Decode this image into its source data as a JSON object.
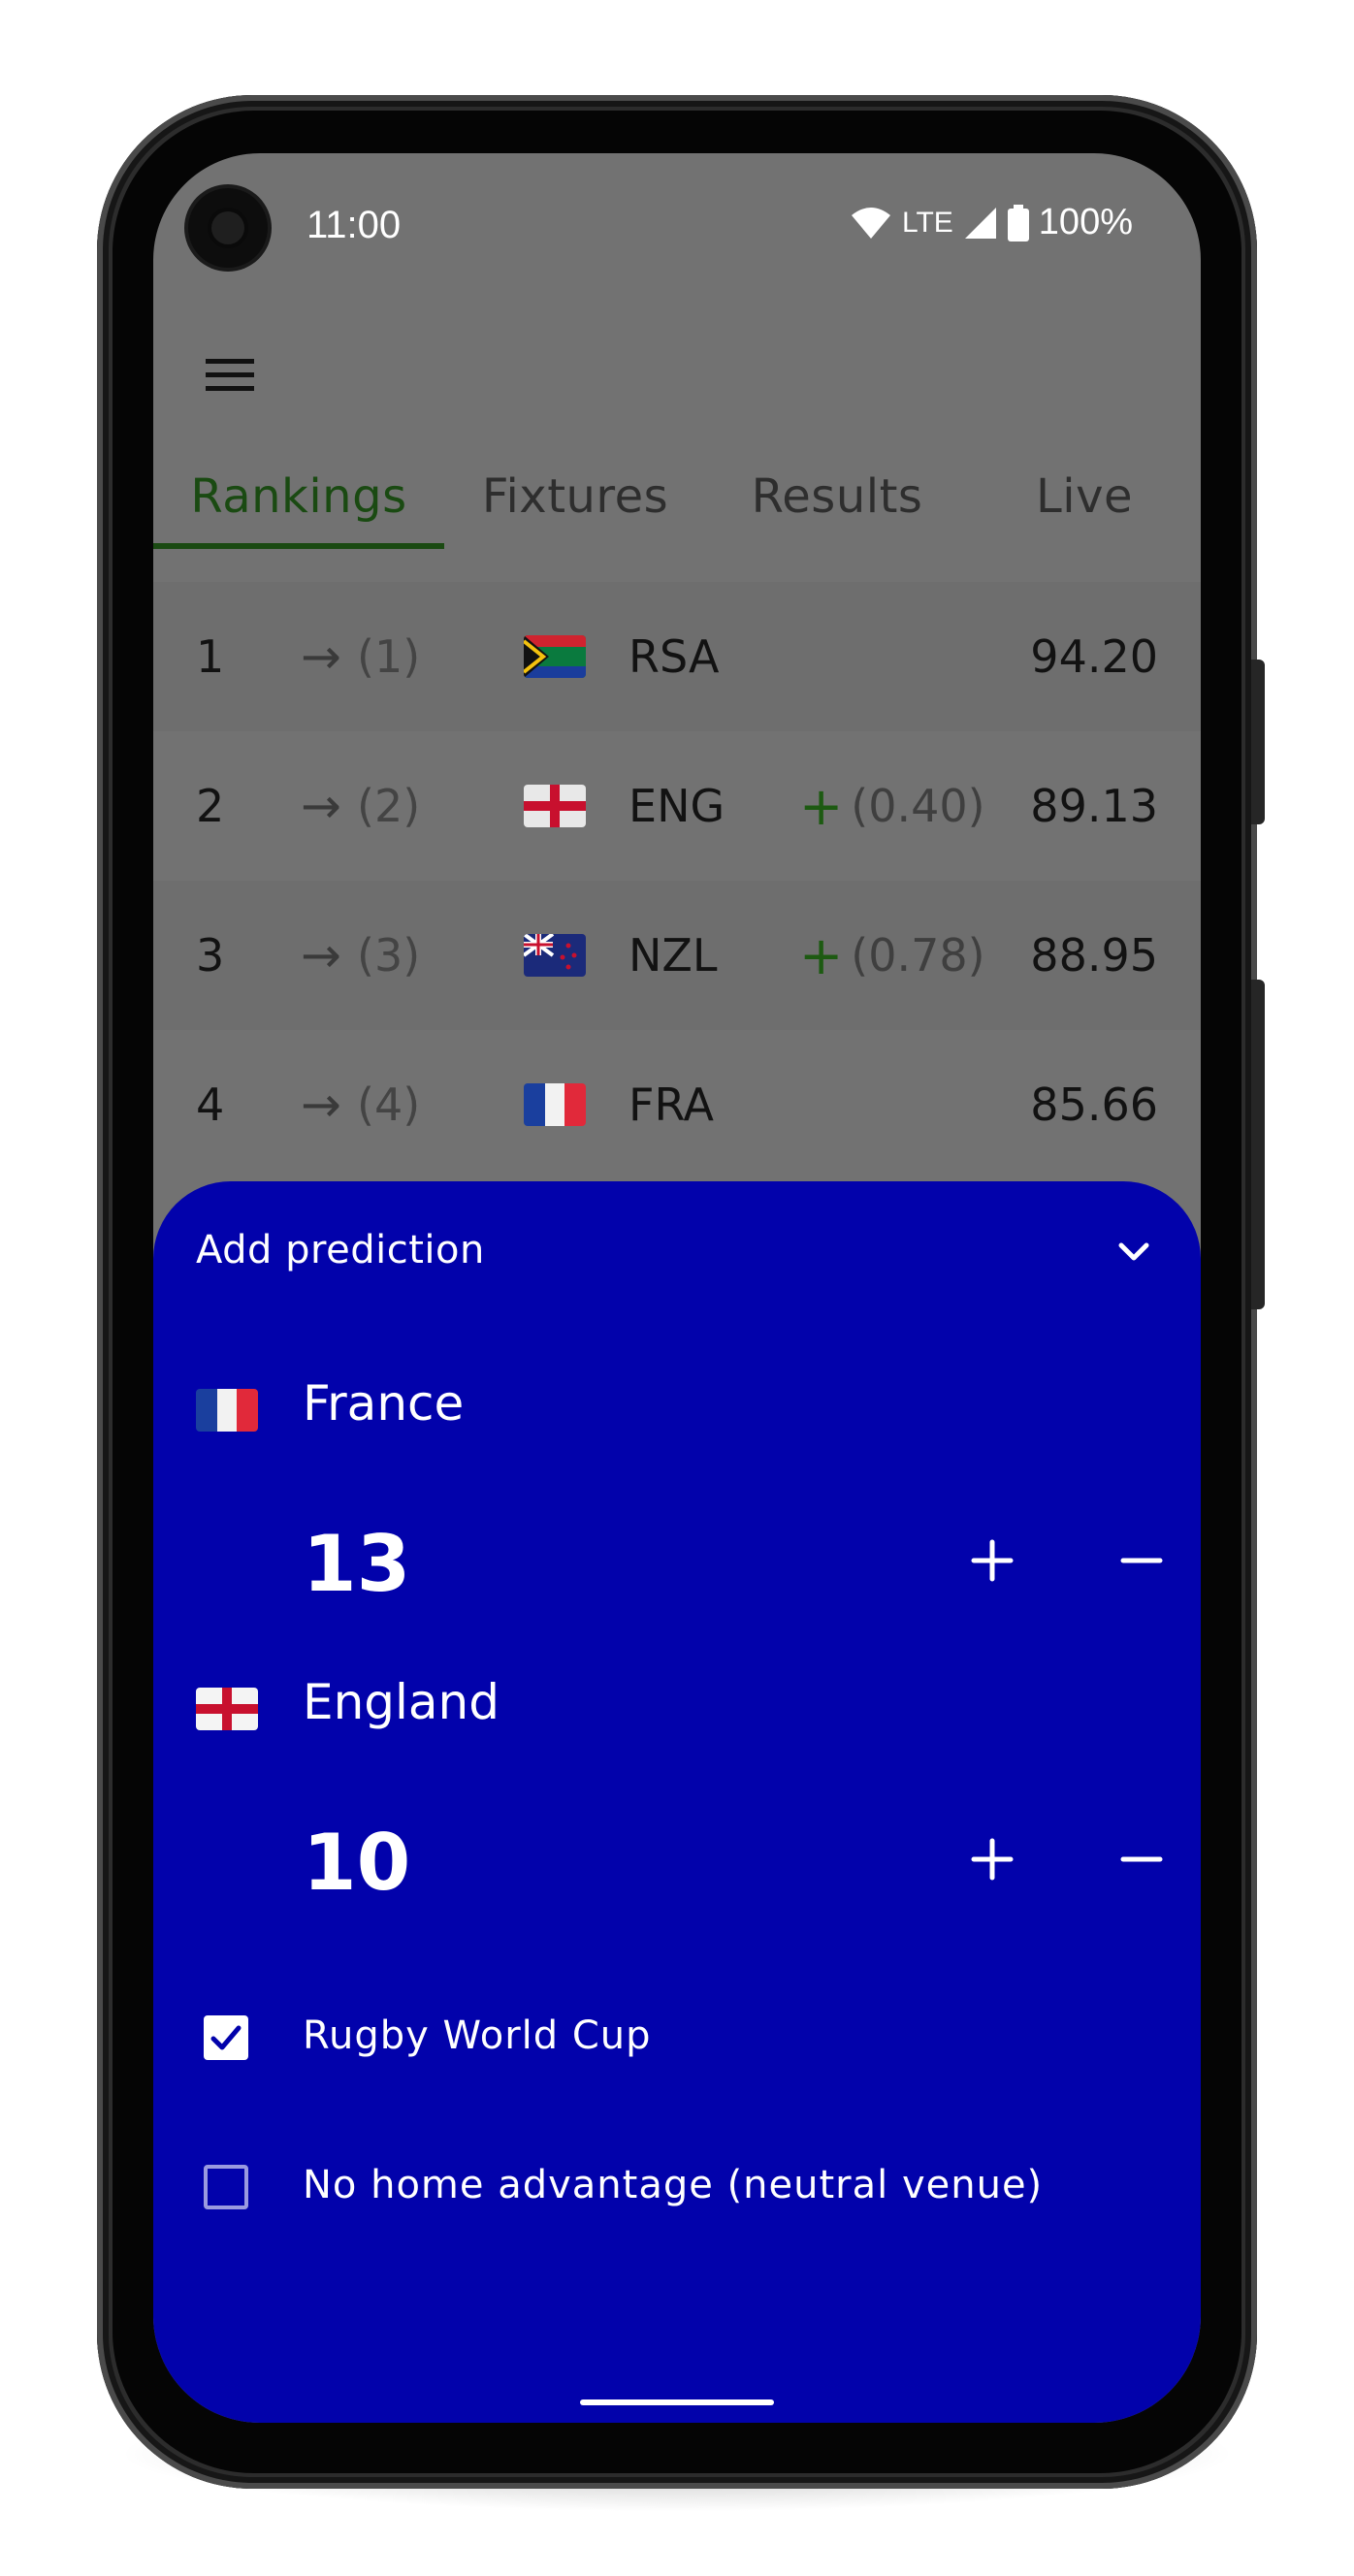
{
  "status_bar": {
    "time": "11:00",
    "network": "LTE",
    "battery": "100%"
  },
  "tabs": [
    {
      "label": "Rankings",
      "active": true
    },
    {
      "label": "Fixtures",
      "active": false
    },
    {
      "label": "Results",
      "active": false
    },
    {
      "label": "Live",
      "active": false
    }
  ],
  "rankings": [
    {
      "position": "1",
      "previous": "(1)",
      "flag": "south-africa-flag",
      "team": "RSA",
      "change": "",
      "points": "94.20"
    },
    {
      "position": "2",
      "previous": "(2)",
      "flag": "england-flag",
      "team": "ENG",
      "change": "(0.40)",
      "points": "89.13"
    },
    {
      "position": "3",
      "previous": "(3)",
      "flag": "new-zealand-flag",
      "team": "NZL",
      "change": "(0.78)",
      "points": "88.95"
    },
    {
      "position": "4",
      "previous": "(4)",
      "flag": "france-flag",
      "team": "FRA",
      "change": "",
      "points": "85.66"
    }
  ],
  "prediction": {
    "title": "Add prediction",
    "home": {
      "team": "France",
      "flag": "france-flag",
      "score": "13"
    },
    "away": {
      "team": "England",
      "flag": "england-flag",
      "score": "10"
    },
    "options": [
      {
        "label": "Rugby World Cup",
        "checked": true
      },
      {
        "label": "No home advantage (neutral venue)",
        "checked": false
      }
    ]
  },
  "colors": {
    "sheet_background": "#0202ab",
    "list_background": "#727272",
    "tab_active": "#1a4a12",
    "increase": "#1d5a12"
  },
  "icons": [
    "menu-icon",
    "arrow-right-icon",
    "plus-icon",
    "minus-icon",
    "chevron-down-icon",
    "check-icon",
    "wifi-icon",
    "signal-icon",
    "battery-icon"
  ]
}
